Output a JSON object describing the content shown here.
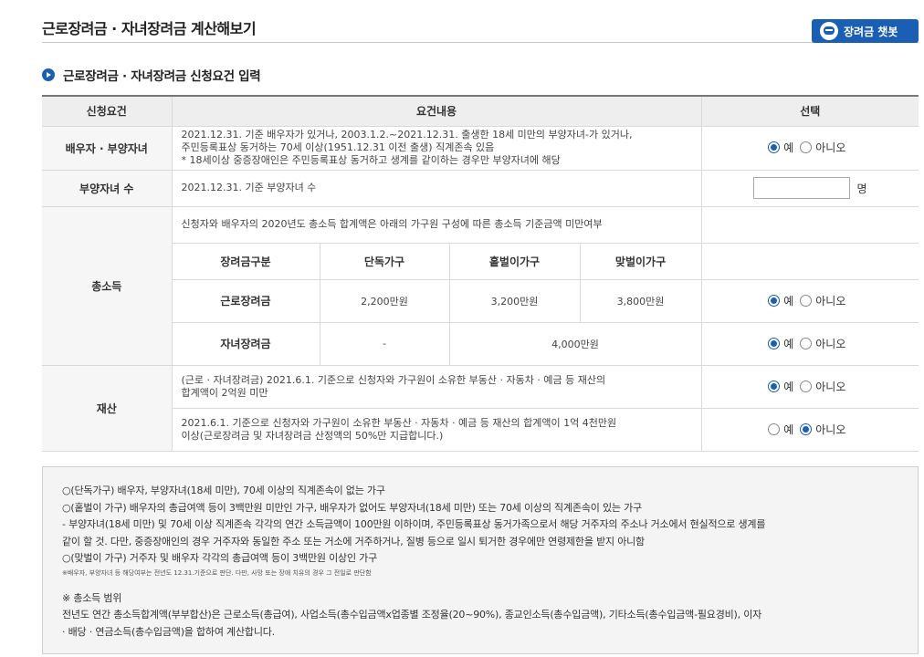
{
  "page": {
    "title": "근로장려금 · 자녀장려금 계산해보기"
  },
  "chatbot": {
    "label": "장려금 챗봇"
  },
  "section": {
    "title": "근로장려금 · 자녀장려금 신청요건 입력"
  },
  "table": {
    "headers": [
      "신청요건",
      "요건내용",
      "선택"
    ],
    "rows": {
      "spouse": {
        "label": "배우자 · 부양자녀",
        "line1": "2021.12.31. 기준 배우자가 있거나, 2003.1.2.~2021.12.31. 출생한 18세 미만의 부양자녀-가 있거나,",
        "line2": "주민등록표상 동거하는 70세 이상(1951.12.31 이전 출생) 직계존속 있음",
        "line3": "* 18세이상 중증장애인은 주민등록표상 동거하고 생계를 같이하는 경우만 부양자녀에 해당"
      },
      "dependents": {
        "label": "부양자녀 수",
        "text": "2021.12.31. 기준 부양자녀 수",
        "input_value": "",
        "unit": "명"
      },
      "income": {
        "label": "총소득",
        "intro": "신청자와 배우자의 2020년도 총소득 합계액은 아래의 가구원 구성에 따른 총소득 기준금액 미만여부",
        "col_headers": [
          "장려금구분",
          "단독가구",
          "홑벌이가구",
          "맞벌이가구"
        ],
        "work": {
          "label": "근로장려금",
          "single": "2,200만원",
          "one_earner": "3,200만원",
          "two_earner": "3,800만원"
        },
        "child": {
          "label": "자녀장려금",
          "single": "-",
          "earner": "4,000만원"
        }
      },
      "property": {
        "label": "재산",
        "row1_line1": "(근로 · 자녀장려금) 2021.6.1. 기준으로 신청자와 가구원이 소유한 부동산 · 자동차 · 예금 등 재산의",
        "row1_line2": "합계액이 2억원 미만",
        "row2_line1": "2021.6.1. 기준으로 신청자와 가구원이 소유한 부동산 · 자동차 · 예금 등 재산의 합계액이 1억 4천만원",
        "row2_line2": "이상(근로장려금 및 자녀장려금 산정액의 50%만 지급합니다.)"
      }
    },
    "radio": {
      "yes": "예",
      "no": "아니오"
    },
    "selections": {
      "spouse": "예",
      "income_work": "예",
      "income_child": "예",
      "property_1": "예",
      "property_2": "아니오"
    }
  },
  "notes": {
    "line1": "○(단독가구) 배우자, 부양자녀(18세 미만), 70세 이상의 직계존속이 없는 가구",
    "line2": "○(홑벌이 가구) 배우자의 총급여액 등이 3백만원 미만인 가구, 배우자가 없어도 부양자녀(18세 미만) 또는 70세 이상의 직계존속이 있는 가구",
    "line3": "- 부양자녀(18세 미만) 및 70세 이상 직계존속 각각의 연간 소득금액이 100만원 이하이며, 주민등록표상 동거가족으로서 해당 거주자의 주소나 거소에서 현실적으로 생계를",
    "line4": "같이 할 것. 다만, 중증장애인의 경우 거주자와 동일한 주소 또는 거소에 거주하거나, 질병 등으로 일시 퇴거한 경우에만 연령제한을 받지 아니함",
    "line5": "○(맞벌이 가구) 거주자 및 배우자 각각의 총급여액 등이 3백만원 이상인 가구",
    "small": "※배우자, 부양자녀 등 해당여부는 전년도 12.31.기준으로 판단. 다만, 사망 또는 장애 치유의 경우 그 전일로 판단함",
    "line6": "※ 총소득 범위",
    "line7": "전년도 연간 총소득합계액(부부합산)은 근로소득(총급여), 사업소득(총수입금액x업종별 조정율(20~90%), 종교인소득(총수입금액), 기타소득(총수입금액-필요경비), 이자",
    "line8": "· 배당 · 연금소득(총수입금액)을 합하여 계산합니다."
  },
  "colors": {
    "accent": "#1a5fb4",
    "header_bg": "#eeeeee",
    "note_bg": "#f4f4f4"
  }
}
